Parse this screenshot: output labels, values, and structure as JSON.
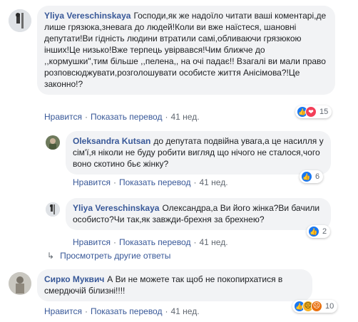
{
  "comments": [
    {
      "author": "Yliya Vereschinskaya",
      "text": "Господи,як же надоїло читати ваші коментарі,де лише грязюка,зневага до людей!Коли ви вже наїстеся, шановні депутати!Ви гідність людини втратили самі,обливаючи грязюкою інших!Це низько!Вже терпець увірвався!Чим ближче до ,,кормушки\",тим більше ,,пелена,, на очі падає!! Взагалі ви мали право розповсюджувати,розголошувати особисте життя Анісімова?!Це законно!?",
      "like_label": "Нравится",
      "translate_label": "Показать перевод",
      "time": "41 нед.",
      "reaction_count": "15"
    },
    {
      "author": "Oleksandra Kutsan",
      "text": "до депутата подвійна увага,а це насилля у сім'ї,я ніколи не буду робити вигляд що нічого не сталося,чого воно скотино бьє жінку?",
      "like_label": "Нравится",
      "translate_label": "Показать перевод",
      "time": "41 нед.",
      "reaction_count": "6"
    },
    {
      "author": "Yliya Vereschinskaya",
      "text": "Олександра,а Ви його жінка?Ви бачили особисто?Чи так,як завжди-брехня за брехнею?",
      "like_label": "Нравится",
      "translate_label": "Показать перевод",
      "time": "41 нед.",
      "reaction_count": "2"
    },
    {
      "author": "Сирко Муквич",
      "text": "А Ви не можете так щоб не покопирхатися в смердючій білизні!!!!",
      "like_label": "Нравится",
      "translate_label": "Показать перевод",
      "time": "41 нед.",
      "reaction_count": "10"
    }
  ],
  "more_replies": {
    "label": "Просмотреть другие ответы",
    "icon": "reply-arrow-icon"
  },
  "separator": "·",
  "colors": {
    "link": "#385898",
    "bubble": "#f2f3f5",
    "like": "#1877f2",
    "love": "#f33e58"
  }
}
